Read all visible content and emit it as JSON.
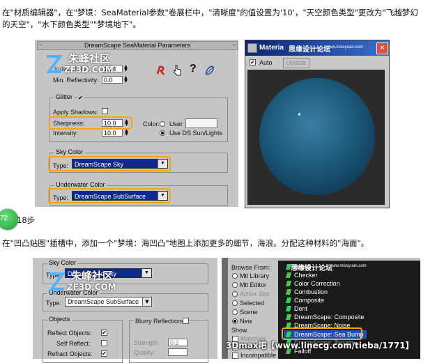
{
  "intro": {
    "line1": "在\"材质编辑器\"，在\"梦境：SeaMaterial参数\"卷展栏中，\"清晰度\"的值设置为'10'，\"天空颜色类型\"更改为\"飞越梦幻",
    "line2": "的天空\"，\"水下颜色类型\"\"梦境地下\"。"
  },
  "shot1": {
    "title": "DreamScape SeaMaterial Parameters",
    "index_label": "Index of Ref.:",
    "index_value": "1.34",
    "min_refl_label": "Min. Reflectivity:",
    "min_refl_value": "0.0",
    "glitter_group": "Glitter",
    "apply_shadows_label": "Apply Shadows:",
    "sharpness_label": "Sharpness:",
    "sharpness_value": "10.0",
    "intensity_label": "Intensity:",
    "intensity_value": "10.0",
    "color_label": "Color:",
    "user_label": "User",
    "ds_label": "Use DS Sun/Lights",
    "sky_group": "Sky Color",
    "type_label": "Type:",
    "sky_type": "DreamScape Sky",
    "uw_group": "Underwater Color",
    "uw_type": "DreamScape SubSurface"
  },
  "preview": {
    "title": "Materia",
    "auto_label": "Auto",
    "update_label": "Update",
    "close_symbol": "✕"
  },
  "watermark": {
    "cn": "朱峰社区",
    "url": "ZF3D.COM",
    "site_cn": "思缘设计论坛",
    "site_url": "www.missyuan.com"
  },
  "step": {
    "badge": "72",
    "suffix": "18步",
    "text": "在\"凹凸贴图\"插槽中，添加一个\"梦境：海凹凸\"地图上添加更多的细节，海浪。分配这种材料的\"海面\"。"
  },
  "shot2": {
    "sky_group": "Sky Color",
    "type_label": "Type:",
    "sky_type": "DreamScape Sky",
    "uw_group": "Underwater Color",
    "uw_type": "DreamScape SubSurface",
    "objects_group": "Objects",
    "blurry_label": "Blurry Reflections",
    "reflect_label": "Reflect Objects:",
    "self_reflect_label": "Self Reflect:",
    "refract_label": "Refract Objects:",
    "strength_label": "Strength:",
    "quality_label": "Quality:",
    "strength_value": "0.2",
    "browse_from": "Browse From:",
    "browse_options": [
      "Mtl Library",
      "Mtl Editor",
      "Active Slot",
      "Selected",
      "Scene",
      "New"
    ],
    "show_label": "Show",
    "show_options": [
      "Materials",
      "Maps",
      "Incompatible"
    ],
    "map_items": [
      "Bricks",
      "Checker",
      "Color Correction",
      "Combustion",
      "Composite",
      "Dent",
      "DreamScape: Composite",
      "DreamScape: Noise",
      "DreamScape: Sea Bump",
      "DreamScape: Terrain",
      "Falloff"
    ],
    "selected_item": "DreamScape: Sea Bump",
    "footer": "3Dmax吧【www.linecg.com/tieba/1771】"
  },
  "colors": {
    "highlight": "#f2a51a",
    "dropdown": "#0c2a8a",
    "panel": "#c5c5c5",
    "list_bg": "#1a1a1a"
  }
}
